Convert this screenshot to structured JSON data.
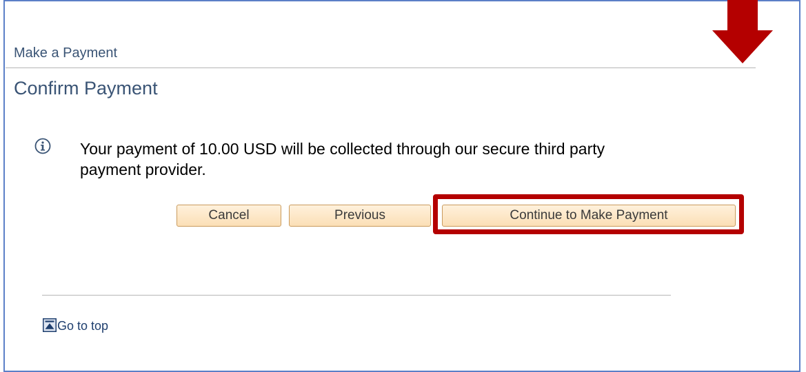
{
  "header": {
    "section_label": "Make a Payment",
    "page_title": "Confirm Payment"
  },
  "message": {
    "text": "Your payment of 10.00 USD will be collected through our secure third party payment provider.",
    "icon": "info-icon"
  },
  "buttons": {
    "cancel_label": "Cancel",
    "previous_label": "Previous",
    "continue_label": "Continue to Make Payment"
  },
  "footer": {
    "go_to_top_label": "Go to top",
    "icon": "go-to-top-icon"
  },
  "annotation": {
    "highlight_color": "#b40000",
    "arrow_icon": "arrow-down-icon"
  },
  "colors": {
    "title_color": "#3a5475",
    "button_fill": "#fbdfb6",
    "button_border": "#c99a5c",
    "link_color": "#1f3f6e",
    "frame_border": "#5b7fc7"
  }
}
